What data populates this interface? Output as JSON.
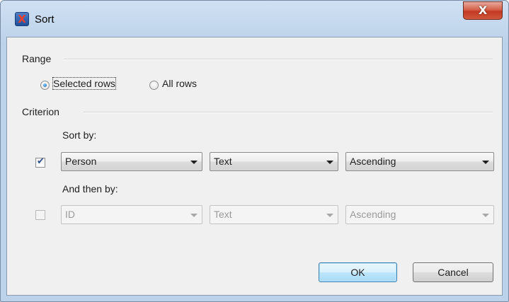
{
  "window": {
    "title": "Sort",
    "close_label": "X"
  },
  "range": {
    "label": "Range",
    "options": [
      {
        "label": "Selected rows",
        "checked": true
      },
      {
        "label": "All rows",
        "checked": false
      }
    ]
  },
  "criterion": {
    "label": "Criterion",
    "sort_by": {
      "label": "Sort by:",
      "enabled": true,
      "field": "Person",
      "type": "Text",
      "order": "Ascending"
    },
    "then_by": {
      "label": "And then by:",
      "enabled": false,
      "field": "ID",
      "type": "Text",
      "order": "Ascending"
    }
  },
  "buttons": {
    "ok": "OK",
    "cancel": "Cancel"
  }
}
